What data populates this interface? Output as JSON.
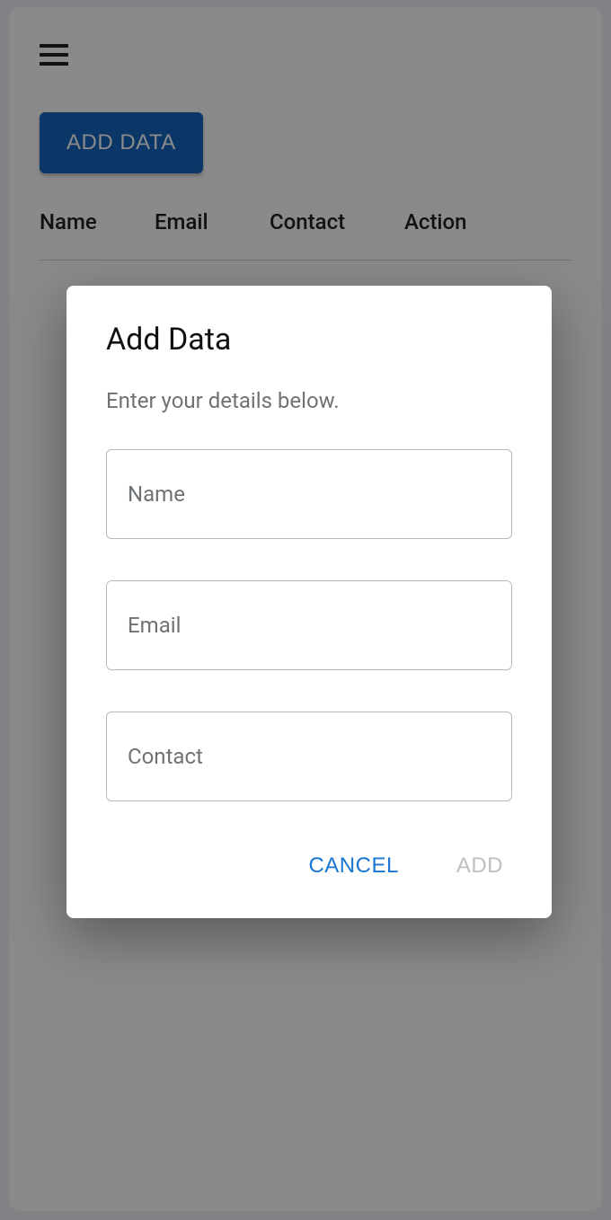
{
  "header": {
    "addDataButton": "ADD DATA"
  },
  "table": {
    "columns": [
      "Name",
      "Email",
      "Contact",
      "Action"
    ]
  },
  "dialog": {
    "title": "Add Data",
    "subtitle": "Enter your details below.",
    "fields": {
      "name": {
        "label": "Name",
        "value": ""
      },
      "email": {
        "label": "Email",
        "value": ""
      },
      "contact": {
        "label": "Contact",
        "value": ""
      }
    },
    "actions": {
      "cancel": "CANCEL",
      "add": "ADD"
    }
  }
}
